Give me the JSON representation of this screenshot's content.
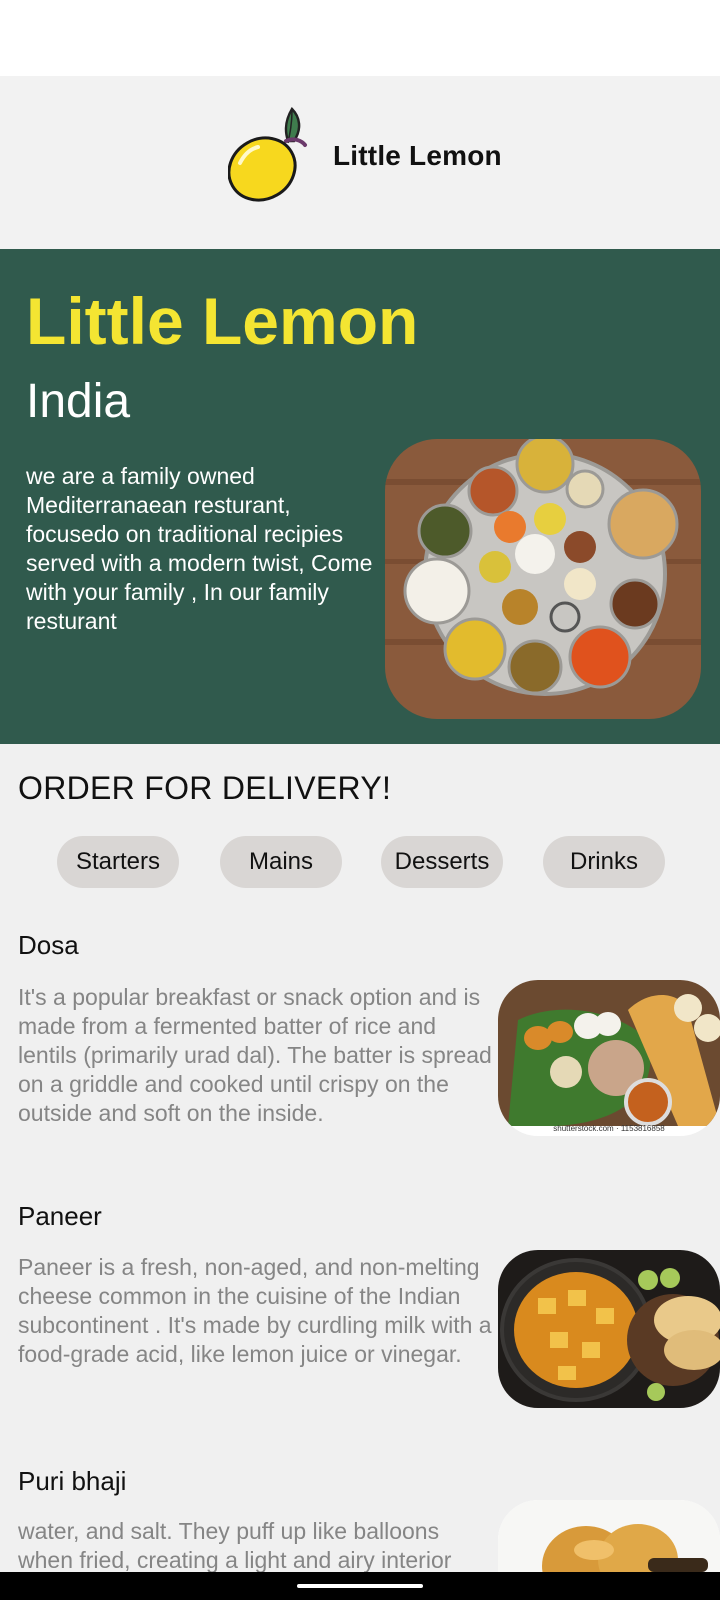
{
  "header": {
    "title": "Little Lemon",
    "logo_icon": "lemon-logo-icon"
  },
  "hero": {
    "title": "Little Lemon",
    "subtitle": "India",
    "description": "we are a family owned Mediterranaean resturant, focusedo on traditional recipies served with a modern twist, Come with your family , In our family resturant",
    "image": "indian-thali-image"
  },
  "order": {
    "heading": "ORDER FOR DELIVERY!",
    "categories": [
      "Starters",
      "Mains",
      "Desserts",
      "Drinks"
    ]
  },
  "menu_items": [
    {
      "name": "Dosa",
      "description": "It's a popular breakfast or snack option and is made from a fermented batter of rice and lentils (primarily urad dal). The batter is spread on a griddle and cooked until crispy on the outside and soft on the inside.",
      "image": "dosa-image",
      "image_caption": "shutterstock.com · 1153816858"
    },
    {
      "name": "Paneer",
      "description": "Paneer is a fresh, non-aged, and non-melting cheese common in the cuisine of the Indian subcontinent . It's made by curdling milk with a food-grade acid, like lemon juice or vinegar.",
      "image": "paneer-image"
    },
    {
      "name": "Puri bhaji",
      "description": "water, and salt. They puff up like balloons when fried, creating a light and airy interior with a crispy exterior.",
      "image": "puri-bhaji-image"
    }
  ],
  "colors": {
    "brand_green": "#305a4d",
    "brand_yellow": "#f4e532",
    "chip_bg": "#d9d6d4"
  }
}
